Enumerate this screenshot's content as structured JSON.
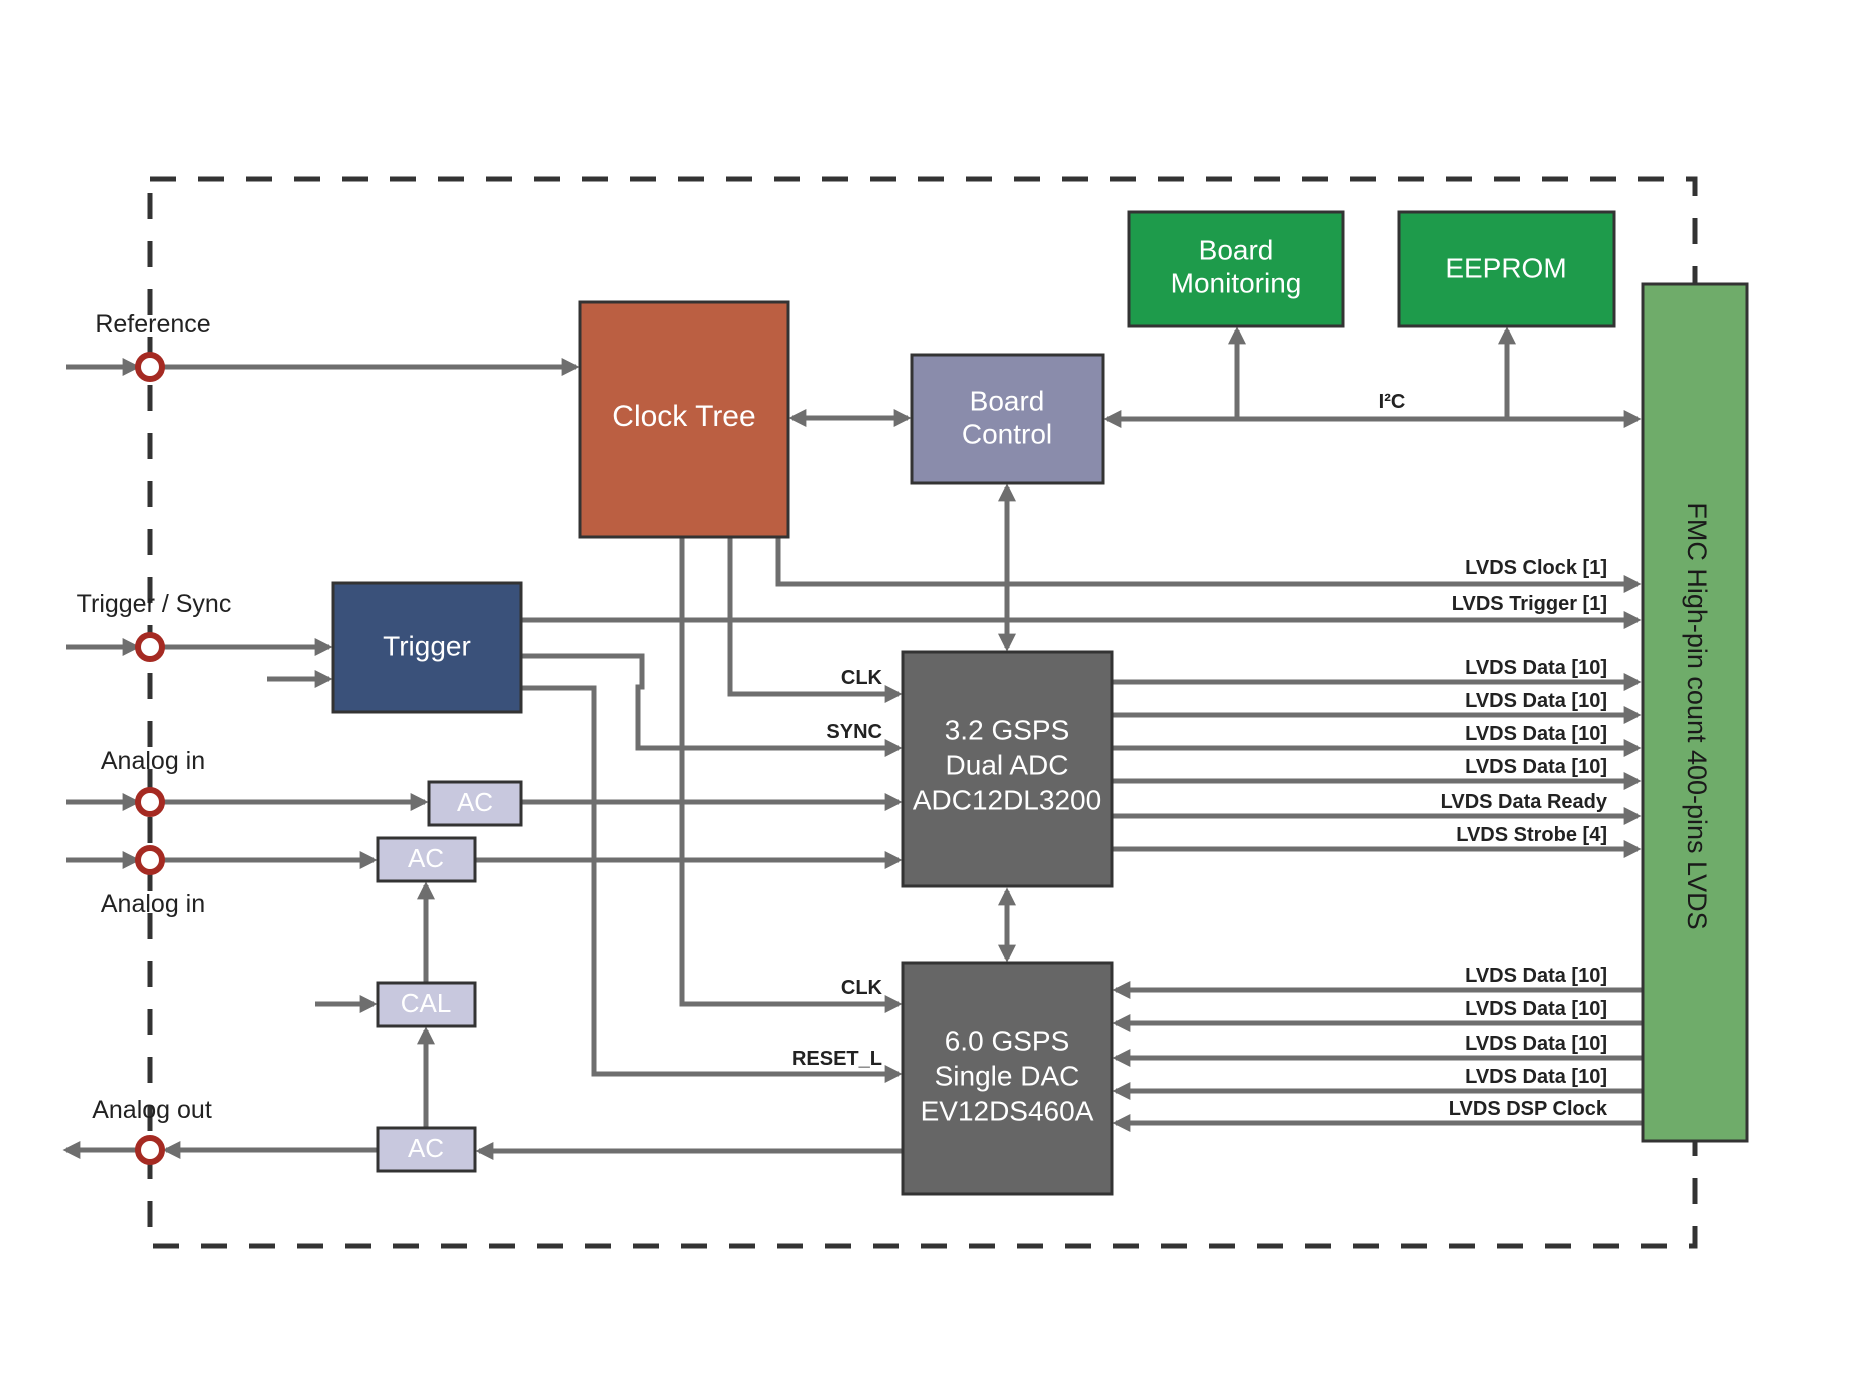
{
  "diagram": {
    "colors": {
      "clock_tree": "#bb5f42",
      "board_control": "#8a8cab",
      "green_block": "#1e9b4b",
      "fmc": "#6fac6a",
      "trigger": "#3a517a",
      "converter": "#666666",
      "ac_cal": "#c8c8de",
      "connector": "#a52a22",
      "wire": "#6e6e6e",
      "border": "#333333"
    },
    "ports": {
      "reference": "Reference",
      "trigger_sync": "Trigger / Sync",
      "analog_in_1": "Analog in",
      "analog_in_2": "Analog in",
      "analog_out": "Analog out"
    },
    "blocks": {
      "clock_tree": "Clock Tree",
      "board_control": [
        "Board",
        "Control"
      ],
      "board_monitoring": [
        "Board",
        "Monitoring"
      ],
      "eeprom": "EEPROM",
      "trigger": "Trigger",
      "ac_1": "AC",
      "ac_2": "AC",
      "cal": "CAL",
      "ac_out": "AC",
      "adc": [
        "3.2 GSPS",
        "Dual ADC",
        "ADC12DL3200"
      ],
      "dac": [
        "6.0 GSPS",
        "Single DAC",
        "EV12DS460A"
      ],
      "fmc": "FMC High-pin count 400-pins LVDS"
    },
    "bus_label": "I²C",
    "adc_inputs": {
      "clk": "CLK",
      "sync": "SYNC"
    },
    "dac_inputs": {
      "clk": "CLK",
      "reset": "RESET_L"
    },
    "fmc_top_signals": [
      "LVDS Clock [1]",
      "LVDS Trigger [1]"
    ],
    "adc_outputs": [
      "LVDS Data [10]",
      "LVDS Data [10]",
      "LVDS Data [10]",
      "LVDS Data [10]",
      "LVDS Data Ready",
      "LVDS Strobe [4]"
    ],
    "dac_inputs_from_fmc": [
      "LVDS Data [10]",
      "LVDS Data [10]",
      "LVDS Data [10]",
      "LVDS Data [10]",
      "LVDS DSP Clock"
    ]
  }
}
